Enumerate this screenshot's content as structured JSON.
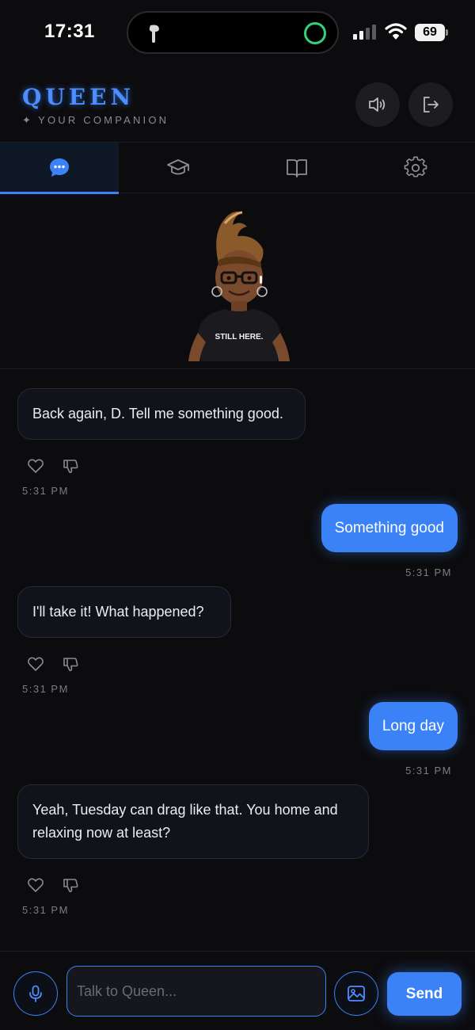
{
  "status_bar": {
    "time": "17:31",
    "battery": "69"
  },
  "header": {
    "title": "QUEEN",
    "subtitle": "YOUR COMPANION",
    "subtitle_star": "✦"
  },
  "tabs": [
    {
      "name": "chat",
      "icon": "chat-bubble-icon",
      "active": true
    },
    {
      "name": "learn",
      "icon": "graduation-cap-icon",
      "active": false
    },
    {
      "name": "journal",
      "icon": "book-icon",
      "active": false
    },
    {
      "name": "settings",
      "icon": "gear-icon",
      "active": false
    }
  ],
  "avatar": {
    "shirt_text": "STILL HERE."
  },
  "messages": [
    {
      "sender": "ai",
      "text": "Back again, D. Tell me something good.",
      "time": "5:31 PM"
    },
    {
      "sender": "user",
      "text": "Something good",
      "time": "5:31 PM"
    },
    {
      "sender": "ai",
      "text": "I'll take it! What happened?",
      "time": "5:31 PM"
    },
    {
      "sender": "user",
      "text": "Long day",
      "time": "5:31 PM"
    },
    {
      "sender": "ai",
      "text_line1": "Yeah, Tuesday can drag like that. You home and",
      "text_line2": "relaxing now at least?",
      "time": "5:31 PM"
    }
  ],
  "composer": {
    "placeholder": "Talk to Queen...",
    "send_label": "Send"
  },
  "colors": {
    "accent": "#3b82f6",
    "background": "#0c0c0e",
    "ai_bubble": "#10131a"
  }
}
